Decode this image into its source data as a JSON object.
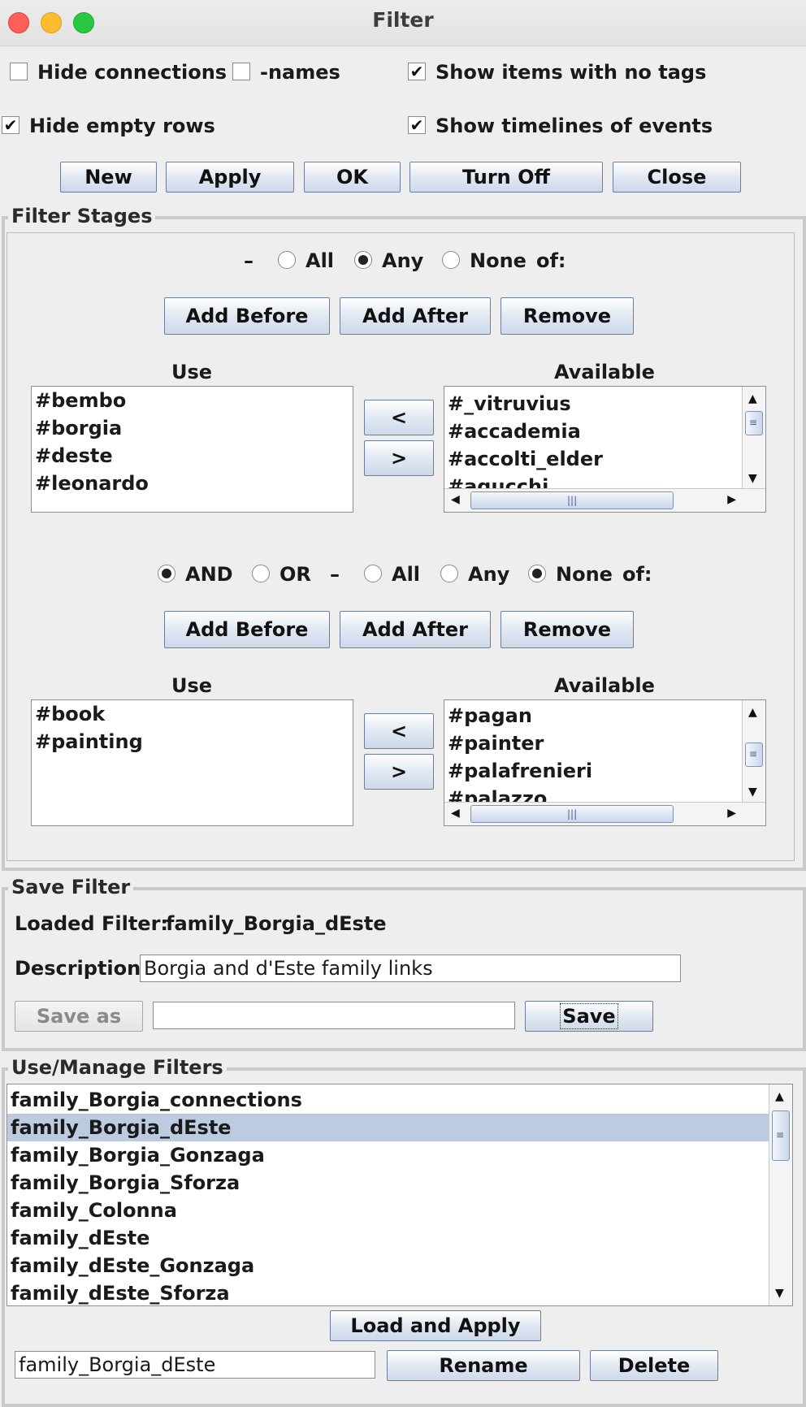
{
  "window": {
    "title": "Filter"
  },
  "options": {
    "hide_connections": {
      "label": "Hide connections",
      "checked": false
    },
    "names": {
      "label": "-names",
      "checked": false
    },
    "show_no_tags": {
      "label": "Show items with no tags",
      "checked": true
    },
    "hide_empty_rows": {
      "label": "Hide empty rows",
      "checked": true
    },
    "show_timelines": {
      "label": "Show timelines of events",
      "checked": true
    },
    "check_mark": "✔"
  },
  "top_buttons": {
    "new": "New",
    "apply": "Apply",
    "ok": "OK",
    "turn_off": "Turn Off",
    "close": "Close"
  },
  "filter_stages": {
    "title": "Filter Stages",
    "stage1": {
      "dash": "–",
      "all": "All",
      "any": "Any",
      "none": "None",
      "of": "of:",
      "selected": "Any",
      "add_before": "Add Before",
      "add_after": "Add After",
      "remove": "Remove",
      "use_header": "Use",
      "available_header": "Available",
      "use_items": [
        "#bembo",
        "#borgia",
        "#deste",
        "#leonardo"
      ],
      "available_items": [
        "#_vitruvius",
        "#accademia",
        "#accolti_elder",
        "#agucchi"
      ],
      "move_left": "<",
      "move_right": ">"
    },
    "stage2": {
      "and": "AND",
      "or": "OR",
      "dash": "–",
      "all": "All",
      "any": "Any",
      "none": "None",
      "of": "of:",
      "logic_selected": "AND",
      "selected": "None",
      "add_before": "Add Before",
      "add_after": "Add After",
      "remove": "Remove",
      "use_header": "Use",
      "available_header": "Available",
      "use_items": [
        "#book",
        "#painting"
      ],
      "available_items": [
        "#pagan",
        "#painter",
        "#palafrenieri",
        "#palazzo"
      ],
      "move_left": "<",
      "move_right": ">"
    }
  },
  "save_filter": {
    "title": "Save Filter",
    "loaded_label": "Loaded Filter:",
    "loaded_value": "family_Borgia_dEste",
    "description_label": "Description",
    "description_value": "Borgia and d'Este family links",
    "save_as": "Save as",
    "save_as_value": "",
    "save": "Save"
  },
  "manage_filters": {
    "title": "Use/Manage Filters",
    "items": [
      "family_Borgia_connections",
      "family_Borgia_dEste",
      "family_Borgia_Gonzaga",
      "family_Borgia_Sforza",
      "family_Colonna",
      "family_dEste",
      "family_dEste_Gonzaga",
      "family_dEste_Sforza"
    ],
    "selected_index": 1,
    "load_apply": "Load and Apply",
    "name_value": "family_Borgia_dEste",
    "rename": "Rename",
    "delete": "Delete"
  },
  "icons": {
    "scroll_up": "▲",
    "scroll_down": "▼",
    "scroll_left": "◀",
    "scroll_right": "▶"
  }
}
